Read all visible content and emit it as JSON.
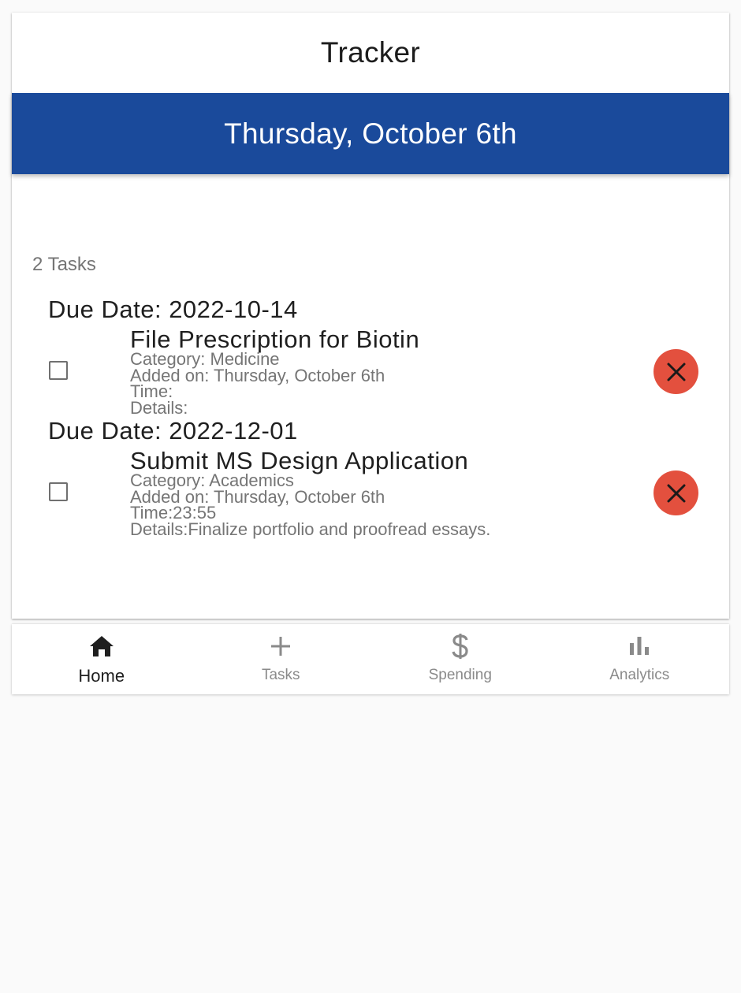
{
  "header": {
    "title": "Tracker",
    "date": "Thursday, October 6th"
  },
  "tasks_summary": "2 Tasks",
  "groups": [
    {
      "due_label": "Due Date: 2022-10-14",
      "task": {
        "title": "File Prescription for Biotin",
        "category": "Category: Medicine",
        "added": "Added on: Thursday, October 6th",
        "time": "Time:",
        "details": "Details:",
        "checked": false
      }
    },
    {
      "due_label": "Due Date: 2022-12-01",
      "task": {
        "title": "Submit MS Design Application",
        "category": "Category: Academics",
        "added": "Added on: Thursday, October 6th",
        "time": "Time:23:55",
        "details": "Details:Finalize portfolio and proofread essays.",
        "checked": false
      }
    }
  ],
  "delete_icon": "close-icon",
  "nav": {
    "items": [
      {
        "label": "Home",
        "icon": "home-icon",
        "active": true
      },
      {
        "label": "Tasks",
        "icon": "plus-icon",
        "active": false
      },
      {
        "label": "Spending",
        "icon": "dollar-icon",
        "active": false
      },
      {
        "label": "Analytics",
        "icon": "bar-chart-icon",
        "active": false
      }
    ]
  },
  "colors": {
    "banner": "#1a4a9b",
    "delete": "#e3503e",
    "muted": "#757575",
    "background": "#fafafa"
  }
}
